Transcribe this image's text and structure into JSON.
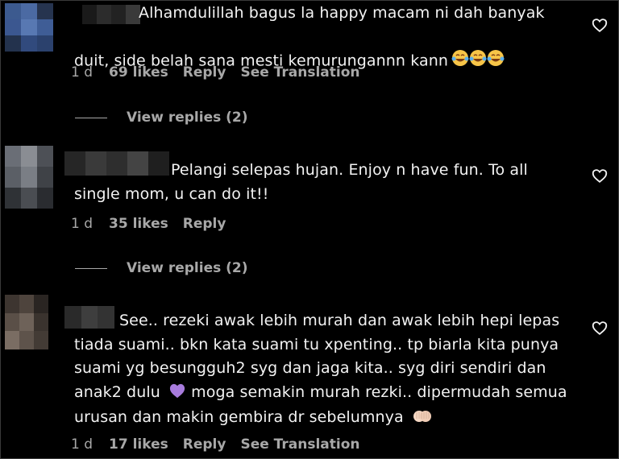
{
  "comments": [
    {
      "text": "Alhamdulillah bagus la happy macam ni dah banyak\nduit, side belah sana mesti kemurungannn kann",
      "emojis": [
        "laughing-tears",
        "laughing-tears",
        "laughing-tears"
      ],
      "time": "1 d",
      "likes": "69 likes",
      "reply": "Reply",
      "translation": "See Translation",
      "view_replies": "View replies (2)"
    },
    {
      "text": "Pelangi selepas hujan. Enjoy n have fun. To all\nsingle mom, u can do it!!",
      "time": "1 d",
      "likes": "35 likes",
      "reply": "Reply",
      "view_replies": "View replies (2)"
    },
    {
      "text_line1": "See.. rezeki awak lebih murah dan awak lebih hepi lepas",
      "text_line2": "tiada suami.. bkn kata suami tu xpenting.. tp biarla kita punya",
      "text_line3": "suami yg besungguh2 syg dan jaga kita.. syg diri sendiri dan",
      "text_line4a": "anak2 dulu",
      "text_line4b": "moga semakin murah rezki.. dipermudah semua",
      "text_line5": "urusan dan makin gembira dr sebelumnya",
      "emojis": [
        "purple-heart",
        "folded-hands"
      ],
      "time": "1 d",
      "likes": "17 likes",
      "reply": "Reply",
      "translation": "See Translation"
    }
  ],
  "colors": {
    "background": "#000000",
    "text": "#f2f2f2",
    "secondary": "#a8a8a8"
  }
}
